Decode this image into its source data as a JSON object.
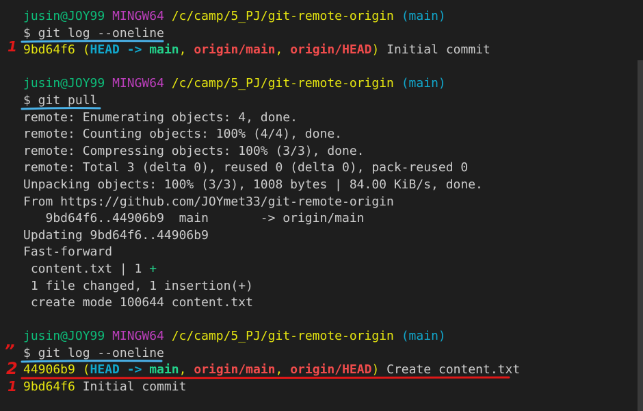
{
  "prompts": [
    {
      "user": "jusin@JOY99",
      "host": "MINGW64",
      "path": "/c/camp/5_PJ/git-remote-origin",
      "branch": "(main)"
    },
    {
      "user": "jusin@JOY99",
      "host": "MINGW64",
      "path": "/c/camp/5_PJ/git-remote-origin",
      "branch": "(main)"
    },
    {
      "user": "jusin@JOY99",
      "host": "MINGW64",
      "path": "/c/camp/5_PJ/git-remote-origin",
      "branch": "(main)"
    }
  ],
  "commands": [
    "$ git log --oneline",
    "$ git pull",
    "$ git log --oneline"
  ],
  "log1": {
    "hash": "9bd64f6",
    "open": " (",
    "head": "HEAD",
    "arrow": " -> ",
    "local": "main",
    "sep1": ", ",
    "remote1": "origin/main",
    "sep2": ", ",
    "remote2": "origin/HEAD",
    "close": ")",
    "message": " Initial commit"
  },
  "pull_output": [
    "remote: Enumerating objects: 4, done.",
    "remote: Counting objects: 100% (4/4), done.",
    "remote: Compressing objects: 100% (3/3), done.",
    "remote: Total 3 (delta 0), reused 0 (delta 0), pack-reused 0",
    "Unpacking objects: 100% (3/3), 1008 bytes | 84.00 KiB/s, done.",
    "From https://github.com/JOYmet33/git-remote-origin",
    "   9bd64f6..44906b9  main       -> origin/main",
    "Updating 9bd64f6..44906b9",
    "Fast-forward"
  ],
  "diffstat": {
    "file": " content.txt | 1 ",
    "plus": "+"
  },
  "summary": [
    " 1 file changed, 1 insertion(+)",
    " create mode 100644 content.txt"
  ],
  "log2": {
    "hash": "44906b9",
    "open": " (",
    "head": "HEAD",
    "arrow": " -> ",
    "local": "main",
    "sep1": ", ",
    "remote1": "origin/main",
    "sep2": ", ",
    "remote2": "origin/HEAD",
    "close": ")",
    "message": " Create content.txt"
  },
  "log3": {
    "hash": "9bd64f6",
    "message": " Initial commit"
  },
  "annotations": {
    "one_a": "1",
    "two": "2",
    "one_b": "1",
    "ditto": "”"
  },
  "colors": {
    "annotation_red": "#e01818",
    "annotation_blue": "#4ab2e8"
  }
}
